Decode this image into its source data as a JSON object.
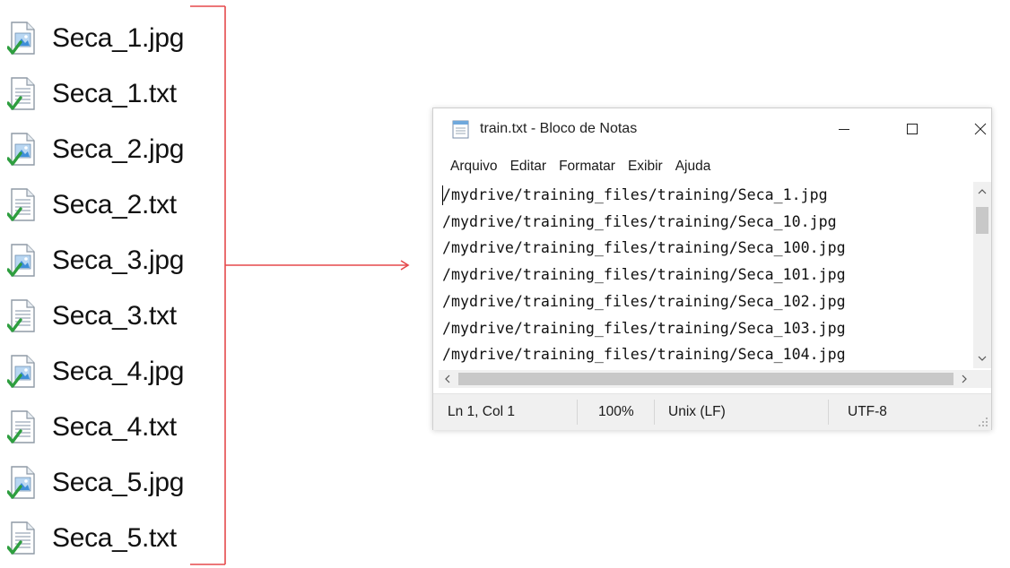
{
  "files": [
    {
      "name": "Seca_1.jpg",
      "icon": "image-file-icon"
    },
    {
      "name": "Seca_1.txt",
      "icon": "text-file-icon"
    },
    {
      "name": "Seca_2.jpg",
      "icon": "image-file-icon"
    },
    {
      "name": "Seca_2.txt",
      "icon": "text-file-icon"
    },
    {
      "name": "Seca_3.jpg",
      "icon": "image-file-icon"
    },
    {
      "name": "Seca_3.txt",
      "icon": "text-file-icon"
    },
    {
      "name": "Seca_4.jpg",
      "icon": "image-file-icon"
    },
    {
      "name": "Seca_4.txt",
      "icon": "text-file-icon"
    },
    {
      "name": "Seca_5.jpg",
      "icon": "image-file-icon"
    },
    {
      "name": "Seca_5.txt",
      "icon": "text-file-icon"
    }
  ],
  "connector": {
    "color": "#e5494b"
  },
  "notepad": {
    "title": "train.txt - Bloco de Notas",
    "menu": [
      "Arquivo",
      "Editar",
      "Formatar",
      "Exibir",
      "Ajuda"
    ],
    "lines": [
      "/mydrive/training_files/training/Seca_1.jpg",
      "/mydrive/training_files/training/Seca_10.jpg",
      "/mydrive/training_files/training/Seca_100.jpg",
      "/mydrive/training_files/training/Seca_101.jpg",
      "/mydrive/training_files/training/Seca_102.jpg",
      "/mydrive/training_files/training/Seca_103.jpg",
      "/mydrive/training_files/training/Seca_104.jpg"
    ],
    "status": {
      "position": "Ln 1, Col 1",
      "zoom": "100%",
      "line_ending": "Unix (LF)",
      "encoding": "UTF-8"
    }
  },
  "colors": {
    "check_green": "#2e9e3f",
    "scrollbar_thumb": "#c8c8c8",
    "statusbar_bg": "#f0f0f0"
  }
}
